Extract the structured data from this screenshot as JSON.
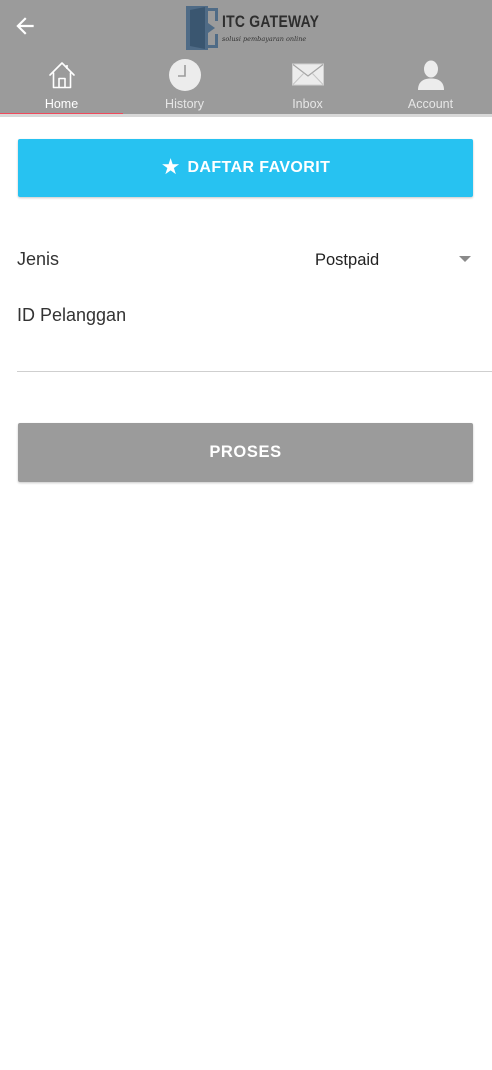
{
  "header": {
    "back_icon": "arrow-left-icon",
    "logo": {
      "title": "ITC GATEWAY",
      "tagline": "solusi pembayaran online",
      "icon": "door-logo-icon"
    },
    "tabs": [
      {
        "label": "Home",
        "icon": "home-icon",
        "active": true
      },
      {
        "label": "History",
        "icon": "clock-icon",
        "active": false
      },
      {
        "label": "Inbox",
        "icon": "envelope-icon",
        "active": false
      },
      {
        "label": "Account",
        "icon": "person-icon",
        "active": false
      }
    ]
  },
  "favorites_button": {
    "label": "DAFTAR FAVORIT",
    "icon": "star-icon"
  },
  "form": {
    "jenis_label": "Jenis",
    "jenis_value": "Postpaid",
    "id_label": "ID Pelanggan",
    "id_value": ""
  },
  "submit_button": {
    "label": "PROSES"
  },
  "colors": {
    "appbar": "#9b9b9b",
    "tab_indicator": "#ef4a5c",
    "favorite_button": "#27c2f1",
    "submit_button": "#9b9b9b"
  }
}
